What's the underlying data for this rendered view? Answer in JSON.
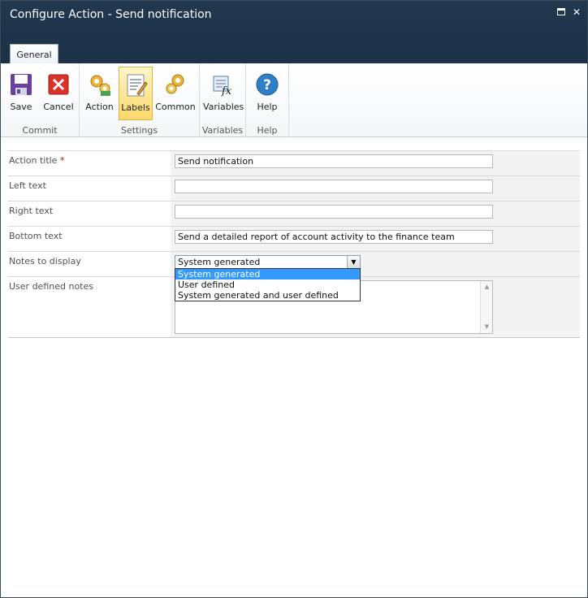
{
  "window": {
    "title": "Configure Action - Send notification"
  },
  "tabs": {
    "general": "General"
  },
  "ribbon": {
    "commit": {
      "label": "Commit",
      "save": "Save",
      "cancel": "Cancel"
    },
    "settings": {
      "label": "Settings",
      "action": "Action",
      "labels": "Labels",
      "common": "Common"
    },
    "variables": {
      "label": "Variables",
      "variables": "Variables"
    },
    "help": {
      "label": "Help",
      "help": "Help"
    }
  },
  "form": {
    "action_title": {
      "label": "Action title",
      "required_mark": "*",
      "value": "Send notification"
    },
    "left_text": {
      "label": "Left text",
      "value": ""
    },
    "right_text": {
      "label": "Right text",
      "value": ""
    },
    "bottom_text": {
      "label": "Bottom text",
      "value": "Send a detailed report of account activity to the finance team"
    },
    "notes_to_display": {
      "label": "Notes to display",
      "value": "System generated",
      "options": [
        "System generated",
        "User defined",
        "System generated and user defined"
      ]
    },
    "user_defined_notes": {
      "label": "User defined notes",
      "value": ""
    }
  },
  "colors": {
    "titlebar": "#1c3147",
    "active_button": "#fbd86a",
    "selected_option": "#3399ff",
    "required": "#cc0000"
  }
}
